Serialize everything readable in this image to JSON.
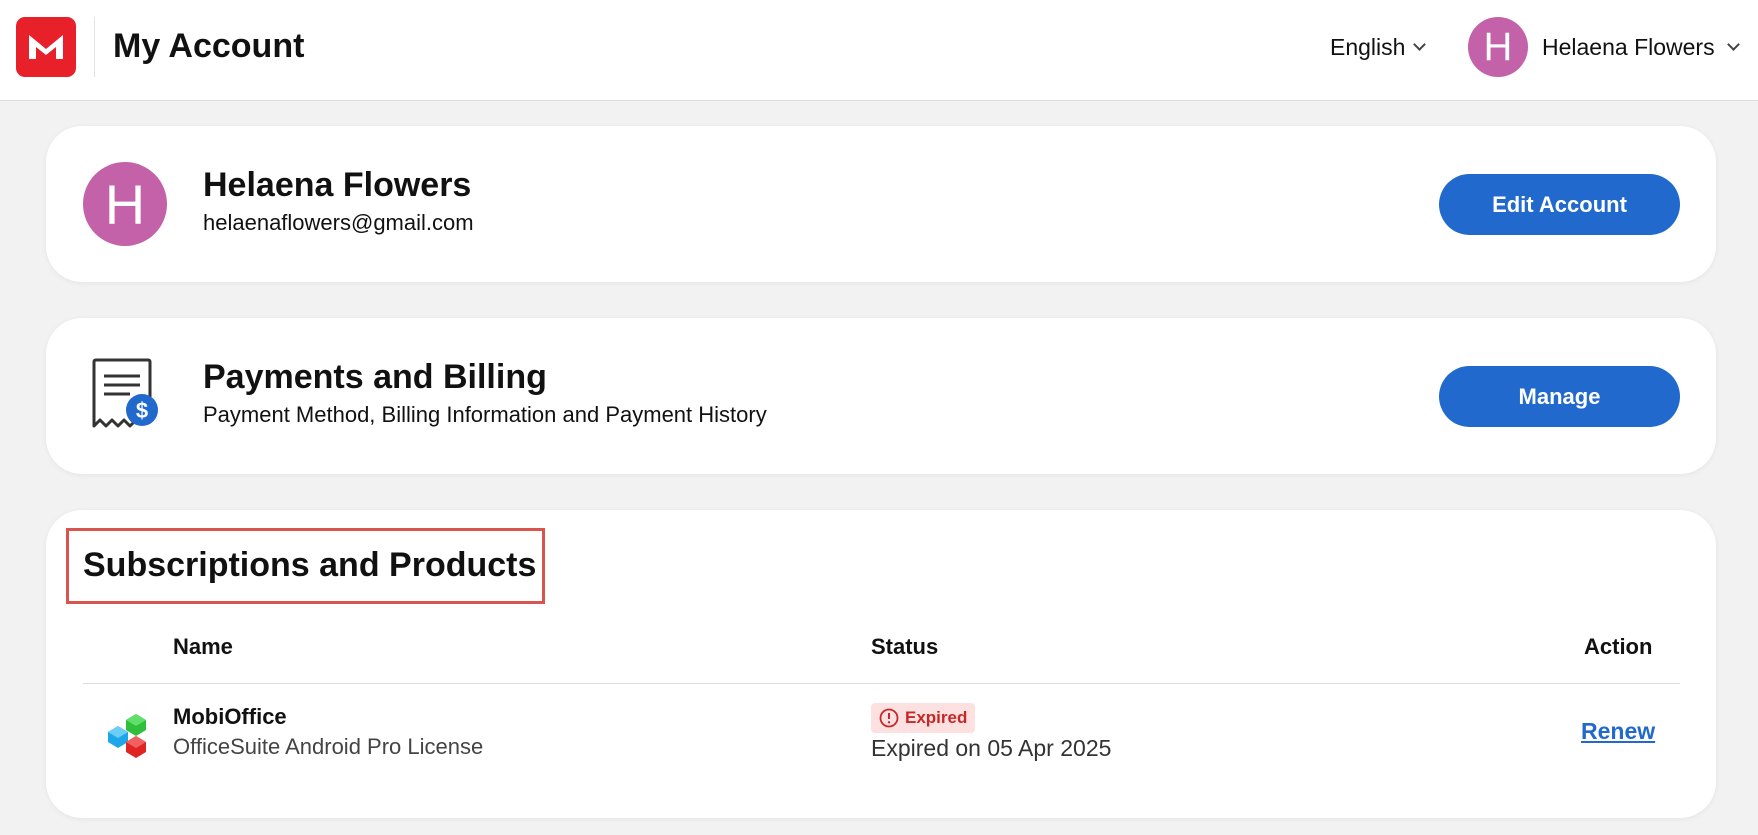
{
  "header": {
    "title": "My Account",
    "language": "English",
    "user_initial": "H",
    "user_name": "Helaena Flowers"
  },
  "account": {
    "initial": "H",
    "name": "Helaena Flowers",
    "email": "helaenaflowers@gmail.com",
    "edit_button": "Edit Account"
  },
  "billing": {
    "title": "Payments and Billing",
    "subtitle": "Payment Method, Billing Information and Payment History",
    "manage_button": "Manage"
  },
  "subscriptions": {
    "title": "Subscriptions and Products",
    "columns": {
      "name": "Name",
      "status": "Status",
      "action": "Action"
    },
    "rows": [
      {
        "product": "MobiOffice",
        "description": "OfficeSuite Android Pro License",
        "status_badge": "Expired",
        "status_detail": "Expired on 05 Apr 2025",
        "action": "Renew"
      }
    ]
  },
  "colors": {
    "brand_red": "#e8202a",
    "primary_blue": "#2169cc",
    "avatar_pink": "#c361a9",
    "expired_red": "#c62828",
    "expired_bg": "#fde1e1",
    "highlight_box": "#d9534f"
  },
  "icons": {
    "logo": "mobisystems-logo-icon",
    "receipt": "receipt-dollar-icon",
    "product": "mobioffice-cubes-icon",
    "alert": "alert-circle-icon",
    "chevron": "chevron-down-icon"
  }
}
